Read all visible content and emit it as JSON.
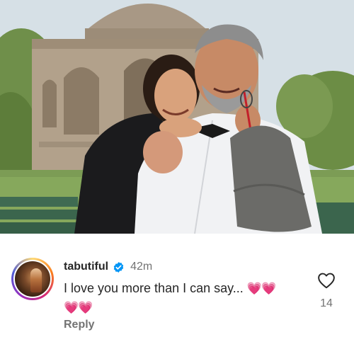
{
  "post": {
    "photo_description_icon": "photo-icon"
  },
  "comment": {
    "username": "tabutiful",
    "verified_icon": "verified-badge-icon",
    "time_ago": "42m",
    "text": "I love you more than I can say...",
    "hearts_inline": "💗💗",
    "hearts_second_line": "💗💗",
    "reply_label": "Reply",
    "like_icon": "heart-outline-icon",
    "like_count": "14"
  },
  "colors": {
    "verified_blue": "#0095f6",
    "text_primary": "#262626",
    "text_secondary": "#737373"
  }
}
